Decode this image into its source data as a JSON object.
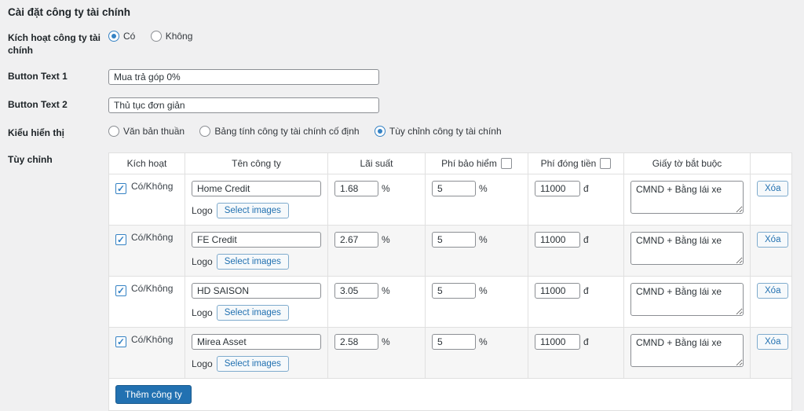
{
  "page": {
    "title": "Cài đặt công ty tài chính"
  },
  "form": {
    "activate": {
      "label": "Kích hoạt công ty tài chính",
      "options": [
        {
          "label": "Có",
          "checked": true
        },
        {
          "label": "Không",
          "checked": false
        }
      ]
    },
    "button_text_1": {
      "label": "Button Text 1",
      "value": "Mua trả góp 0%"
    },
    "button_text_2": {
      "label": "Button Text 2",
      "value": "Thủ tục đơn giản"
    },
    "display_type": {
      "label": "Kiểu hiển thị",
      "options": [
        {
          "label": "Văn bản thuần",
          "checked": false
        },
        {
          "label": "Bảng tính công ty tài chính cố định",
          "checked": false
        },
        {
          "label": "Tùy chỉnh công ty tài chính",
          "checked": true
        }
      ]
    },
    "customize_label": "Tùy chỉnh"
  },
  "table": {
    "headers": {
      "activate": "Kích hoạt",
      "company": "Tên công ty",
      "rate": "Lãi suất",
      "insurance": "Phí bảo hiểm",
      "insurance_checked": false,
      "payment": "Phí đóng tiền",
      "payment_checked": false,
      "documents": "Giấy tờ bắt buộc"
    },
    "labels": {
      "toggle": "Có/Không",
      "logo": "Logo",
      "select_images": "Select images",
      "delete": "Xóa",
      "percent": "%",
      "currency": "đ",
      "check_glyph": "✓"
    },
    "rows": [
      {
        "enabled": true,
        "company": "Home Credit",
        "rate": "1.68",
        "insurance": "5",
        "payment": "11000",
        "documents": "CMND + Bằng lái xe"
      },
      {
        "enabled": true,
        "company": "FE Credit",
        "rate": "2.67",
        "insurance": "5",
        "payment": "11000",
        "documents": "CMND + Bằng lái xe"
      },
      {
        "enabled": true,
        "company": "HD SAISON",
        "rate": "3.05",
        "insurance": "5",
        "payment": "11000",
        "documents": "CMND + Bằng lái xe"
      },
      {
        "enabled": true,
        "company": "Mirea Asset",
        "rate": "2.58",
        "insurance": "5",
        "payment": "11000",
        "documents": "CMND + Bằng lái xe"
      }
    ],
    "add_button": "Thêm công ty"
  },
  "colors": {
    "accent": "#2271b1",
    "selection_blue": "#3582c4",
    "page_background": "#f0f0f1"
  }
}
